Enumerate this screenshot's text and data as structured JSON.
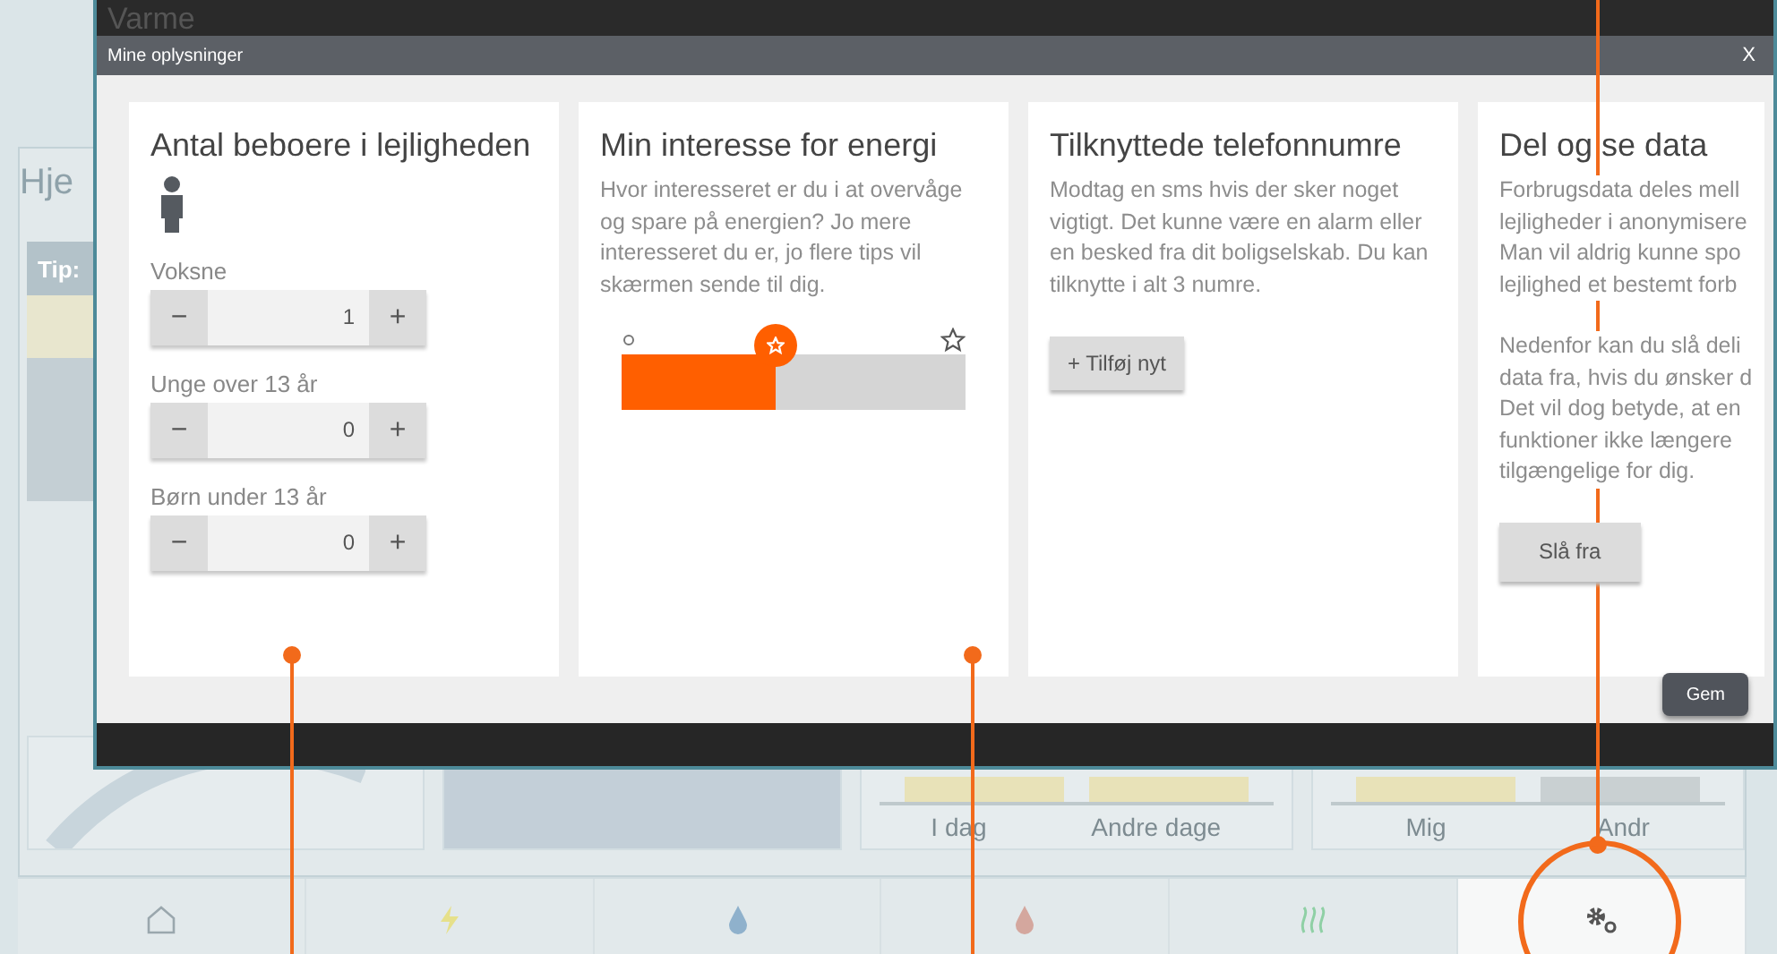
{
  "header": {
    "title": "Varme"
  },
  "background": {
    "page_title": "Hje",
    "tip": "Tip:",
    "chart_labels": [
      "I dag",
      "Andre dage"
    ],
    "compare_labels": [
      "Mig",
      "Andr"
    ]
  },
  "nav": [
    {
      "kind": "home",
      "selected": false
    },
    {
      "kind": "power",
      "selected": false
    },
    {
      "kind": "water",
      "selected": false
    },
    {
      "kind": "hotwater",
      "selected": false
    },
    {
      "kind": "heat",
      "selected": false
    },
    {
      "kind": "settings",
      "selected": true
    }
  ],
  "dialog": {
    "title": "Mine oplysninger",
    "close": "X",
    "save": "Gem",
    "cards": [
      {
        "kind": "counters",
        "title": "Antal beboere i lejligheden",
        "counters": [
          {
            "label": "Voksne",
            "value": "1",
            "minus": "−",
            "plus": "+"
          },
          {
            "label": "Unge over 13 år",
            "value": "0",
            "minus": "−",
            "plus": "+"
          },
          {
            "label": "Børn under 13 år",
            "value": "0",
            "minus": "−",
            "plus": "+"
          }
        ]
      },
      {
        "kind": "slider",
        "title": "Min interesse for energi",
        "text": "Hvor interesseret er du i at overvåge og spare på energien? Jo mere interesseret du er, jo flere tips vil skærmen sende til dig.",
        "level": 0.45
      },
      {
        "kind": "phones",
        "title": "Tilknyttede telefonnumre",
        "text": "Modtag en sms hvis der sker noget vigtigt. Det kunne være en alarm eller en besked fra dit boligselskab. Du kan tilknytte i alt 3 numre.",
        "button": "+ Tilføj nyt"
      },
      {
        "kind": "share",
        "title": "Del og se data",
        "lines": [
          "Forbrugsdata deles mell",
          "lejligheder i anonymisere",
          "Man vil aldrig kunne spo",
          "lejlighed et bestemt forb"
        ],
        "lines2": [
          "Nedenfor kan du slå deli",
          "data fra, hvis du ønsker d",
          "Det vil dog betyde, at en",
          "funktioner ikke længere",
          "tilgængelige for dig."
        ],
        "button": "Slå fra"
      }
    ]
  }
}
